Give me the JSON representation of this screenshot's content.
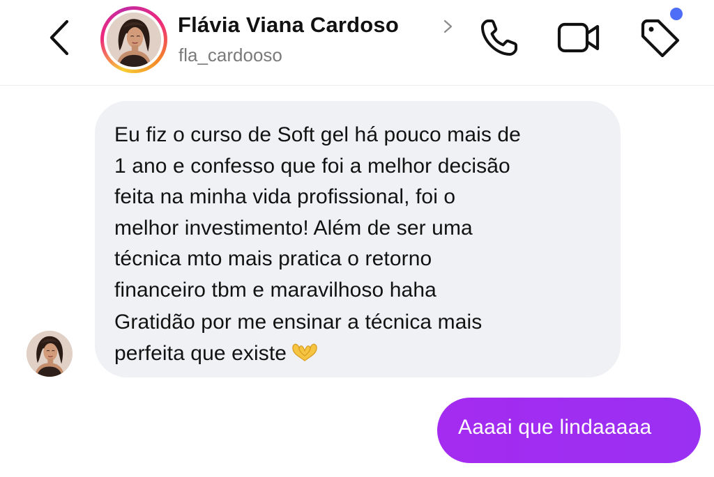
{
  "header": {
    "contact_name": "Flávia Viana Cardoso",
    "username": "fla_cardooso",
    "icons": {
      "back": "chevron-left-icon",
      "name_chevron": "chevron-right-icon",
      "call": "phone-icon",
      "video": "video-camera-icon",
      "label": "tag-icon"
    },
    "notification_dot_color": "#4f6ef7"
  },
  "conversation": {
    "incoming": {
      "lines": [
        "Eu fiz o curso de Soft gel há pouco mais de",
        "1 ano e confesso que foi a melhor decisão",
        "feita na minha vida profissional, foi o",
        "melhor investimento! Além de ser uma",
        "técnica mto mais pratica o retorno",
        "financeiro tbm e maravilhoso haha",
        "Gratidão por me ensinar a técnica mais",
        "perfeita que existe"
      ],
      "emoji": "heart-hands-emoji",
      "bubble_color": "#eff1f4"
    },
    "outgoing": {
      "text": "Aaaai que lindaaaaa",
      "bubble_color": "#9b2cf2"
    }
  }
}
